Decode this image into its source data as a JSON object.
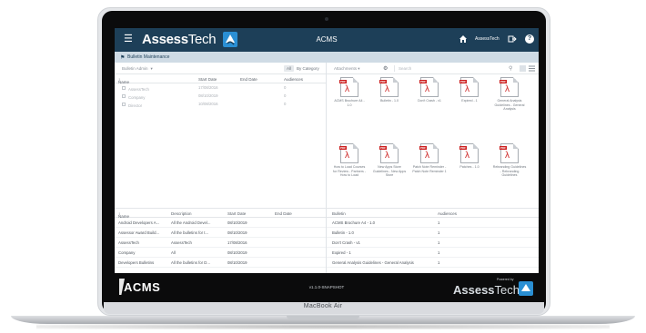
{
  "device": {
    "model_label": "MacBook Air"
  },
  "header": {
    "brand_bold": "Assess",
    "brand_light": "Tech",
    "app_title": "ACMS",
    "user": "AssessTech",
    "help_label": "?"
  },
  "breadcrumb": {
    "label": "Bulletin Maintenance"
  },
  "left_panel": {
    "dropdown_label": "Bulletin Admin",
    "all_button": "All",
    "category_button": "By Category",
    "columns": [
      "Name",
      "Start Date",
      "End Date",
      "Audiences"
    ],
    "rows": [
      {
        "name": "AssessTech",
        "start": "17/08/2016",
        "end": "",
        "audiences": "0"
      },
      {
        "name": "Company",
        "start": "08/10/2019",
        "end": "",
        "audiences": "0"
      },
      {
        "name": "Director",
        "start": "10/08/2016",
        "end": "",
        "audiences": "0"
      }
    ]
  },
  "right_panel": {
    "dropdown_label": "Attachments",
    "search_placeholder": "Search",
    "files": [
      {
        "label": "ACMS Brochure A4 - 1.0"
      },
      {
        "label": "Bulletin - 1.0"
      },
      {
        "label": "Don't Crash - v1"
      },
      {
        "label": "Expired - 1"
      },
      {
        "label": "General Analysis Guidelines - General Analysis"
      },
      {
        "label": "How to Load Courses for Review - Partners - How to Load"
      },
      {
        "label": "New Apps Store Guidelines - New Apps Store"
      },
      {
        "label": "Patch Note Reminder - Patch Note Reminder 1"
      },
      {
        "label": "Patches - 1.0"
      },
      {
        "label": "Rebranding Guidelines - Rebranding Guidelines"
      }
    ]
  },
  "bottom_left": {
    "columns": [
      "Name",
      "Description",
      "Start Date",
      "End Date"
    ],
    "rows": [
      {
        "name": "Android Developers A...",
        "description": "All the Android Devel...",
        "start": "08/10/2019",
        "end": ""
      },
      {
        "name": "Assessor Award Build...",
        "description": "All the bulletins for t...",
        "start": "08/10/2019",
        "end": ""
      },
      {
        "name": "AssessTech",
        "description": "AssessTech",
        "start": "17/08/2016",
        "end": ""
      },
      {
        "name": "Company",
        "description": "All",
        "start": "08/10/2019",
        "end": ""
      },
      {
        "name": "Developers Bulletins",
        "description": "All the bulletins for D...",
        "start": "08/10/2019",
        "end": ""
      }
    ]
  },
  "bottom_right": {
    "columns": [
      "Bulletin",
      "Audiences"
    ],
    "rows": [
      {
        "bulletin": "ACMS Brochure A4 - 1.0",
        "audiences": "1"
      },
      {
        "bulletin": "Bulletin - 1.0",
        "audiences": "1"
      },
      {
        "bulletin": "Don't Crash - v1",
        "audiences": "1"
      },
      {
        "bulletin": "Expired - 1",
        "audiences": "1"
      },
      {
        "bulletin": "General Analysis Guidelines - General Analysis",
        "audiences": "1"
      }
    ]
  },
  "footer": {
    "logo": "ACMS",
    "version": "v1.1.0-SNAPSHOT",
    "powered_by": "Powered by",
    "brand_bold": "Assess",
    "brand_light": "Tech"
  },
  "colors": {
    "header": "#1d3f58",
    "breadcrumb": "#cfdbe5",
    "footer": "#0b0b0c",
    "pdf_red": "#cc1f1f"
  }
}
